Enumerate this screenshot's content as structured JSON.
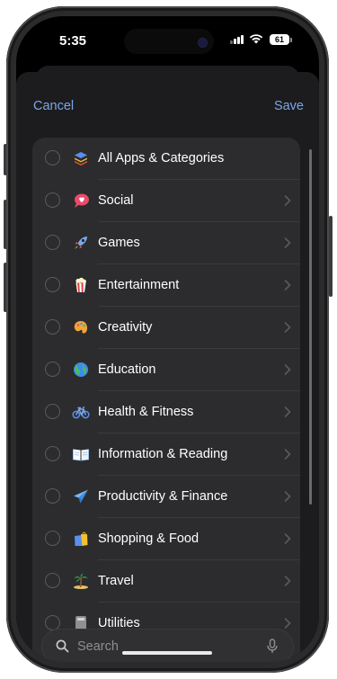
{
  "status_bar": {
    "time": "5:35",
    "battery_level": "61",
    "icons": [
      "signal-icon",
      "wifi-icon",
      "battery-icon"
    ]
  },
  "nav": {
    "cancel_label": "Cancel",
    "save_label": "Save"
  },
  "categories": [
    {
      "label": "All Apps & Categories",
      "icon": "stack-icon",
      "has_chevron": false
    },
    {
      "label": "Social",
      "icon": "speech-bubble-heart-icon",
      "has_chevron": true
    },
    {
      "label": "Games",
      "icon": "rocket-icon",
      "has_chevron": true
    },
    {
      "label": "Entertainment",
      "icon": "popcorn-icon",
      "has_chevron": true
    },
    {
      "label": "Creativity",
      "icon": "palette-icon",
      "has_chevron": true
    },
    {
      "label": "Education",
      "icon": "globe-icon",
      "has_chevron": true
    },
    {
      "label": "Health & Fitness",
      "icon": "bicycle-icon",
      "has_chevron": true
    },
    {
      "label": "Information & Reading",
      "icon": "book-icon",
      "has_chevron": true
    },
    {
      "label": "Productivity & Finance",
      "icon": "paper-plane-icon",
      "has_chevron": true
    },
    {
      "label": "Shopping & Food",
      "icon": "shopping-bag-icon",
      "has_chevron": true
    },
    {
      "label": "Travel",
      "icon": "palm-tree-icon",
      "has_chevron": true
    },
    {
      "label": "Utilities",
      "icon": "calculator-icon",
      "has_chevron": true
    }
  ],
  "search": {
    "placeholder": "Search",
    "icons": [
      "search-icon",
      "microphone-icon"
    ]
  },
  "colors": {
    "accent": "#7aa7e8",
    "sheet_bg": "#1c1c1e",
    "card_bg": "#2c2c2e"
  }
}
